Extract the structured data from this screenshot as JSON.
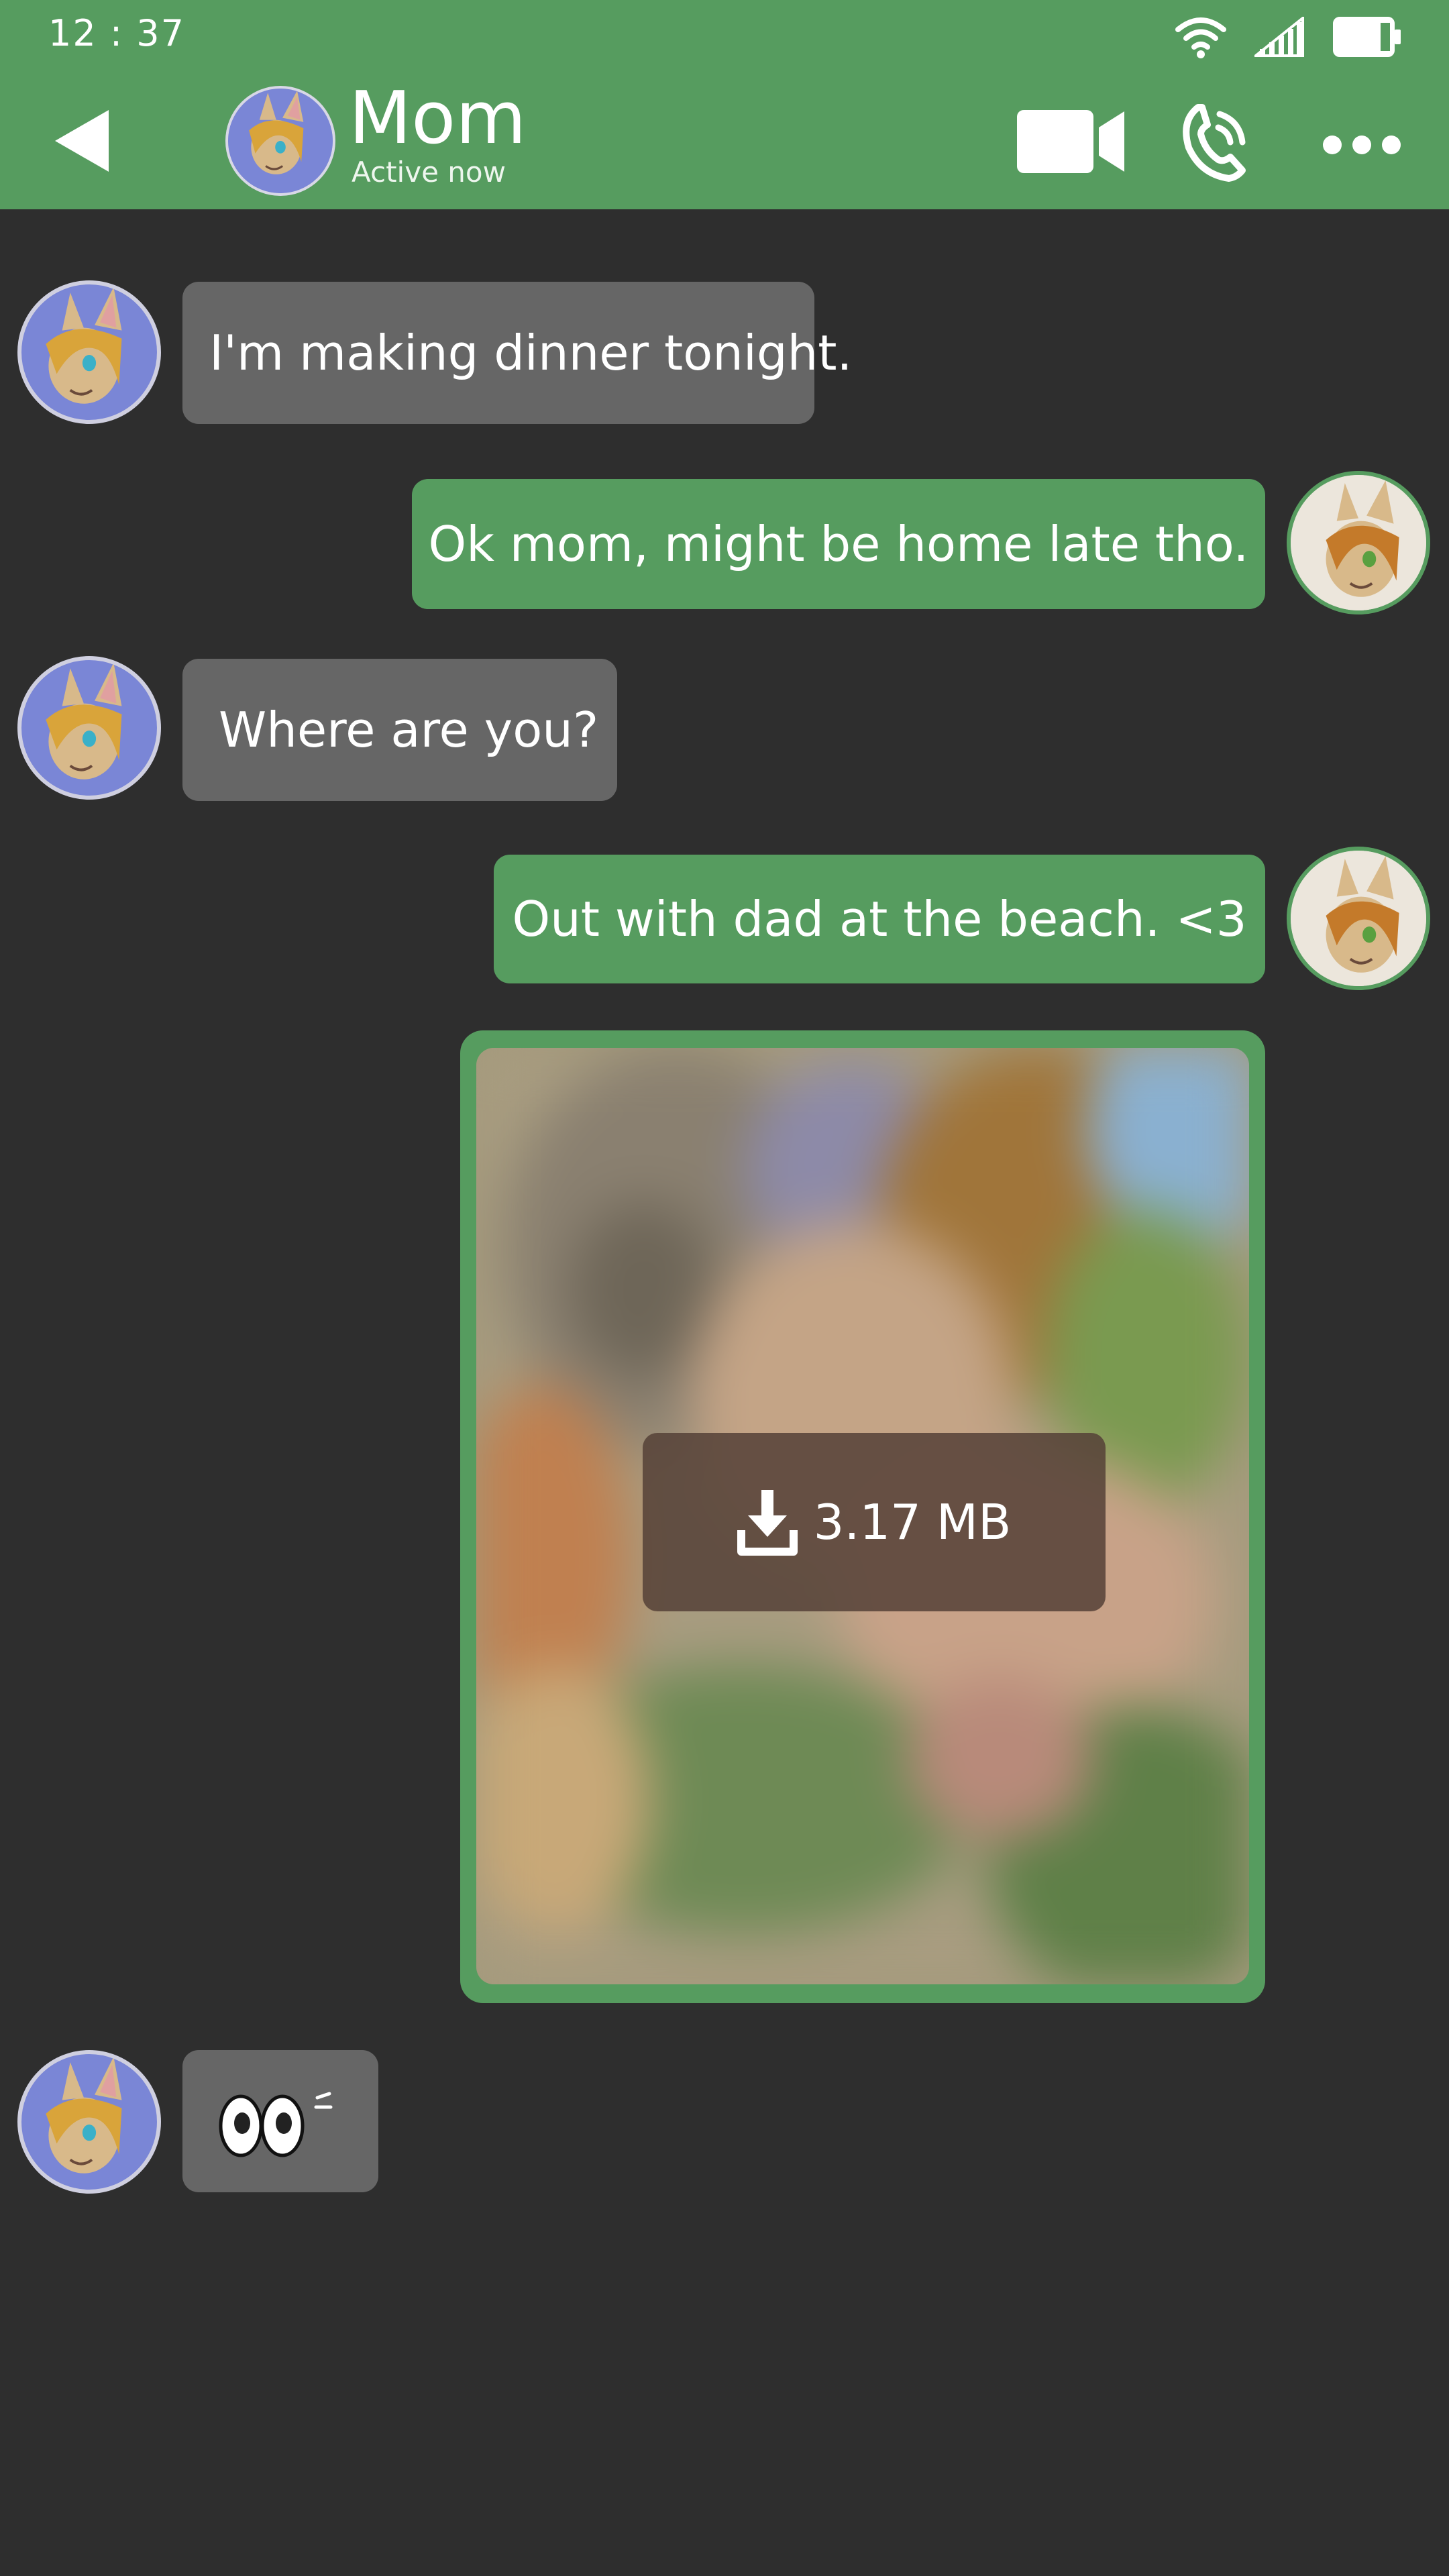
{
  "status_bar": {
    "time": "12 : 37"
  },
  "header": {
    "contact_name": "Mom",
    "contact_status": "Active now",
    "icons": [
      "back-arrow-icon",
      "video-camera-icon",
      "phone-call-icon",
      "more-dots-icon"
    ]
  },
  "messages": [
    {
      "sender": "Mom",
      "direction": "incoming",
      "text": "I'm making dinner tonight."
    },
    {
      "sender": "me",
      "direction": "outgoing",
      "text": "Ok mom, might be home late tho."
    },
    {
      "sender": "Mom",
      "direction": "incoming",
      "text": "Where are you?"
    },
    {
      "sender": "me",
      "direction": "outgoing",
      "text": "Out with dad at the beach. <3"
    },
    {
      "sender": "me",
      "direction": "outgoing",
      "type": "image",
      "size": "3.17 MB",
      "state": "blurred-not-downloaded"
    },
    {
      "sender": "Mom",
      "direction": "incoming",
      "type": "emoji",
      "emoji": "staring-eyes"
    }
  ],
  "colors": {
    "accent": "#569c5f",
    "background": "#2e2e2e",
    "incoming_bubble": "#666666",
    "outgoing_bubble": "#569c5f",
    "mom_avatar_bg": "#7a86d6"
  }
}
